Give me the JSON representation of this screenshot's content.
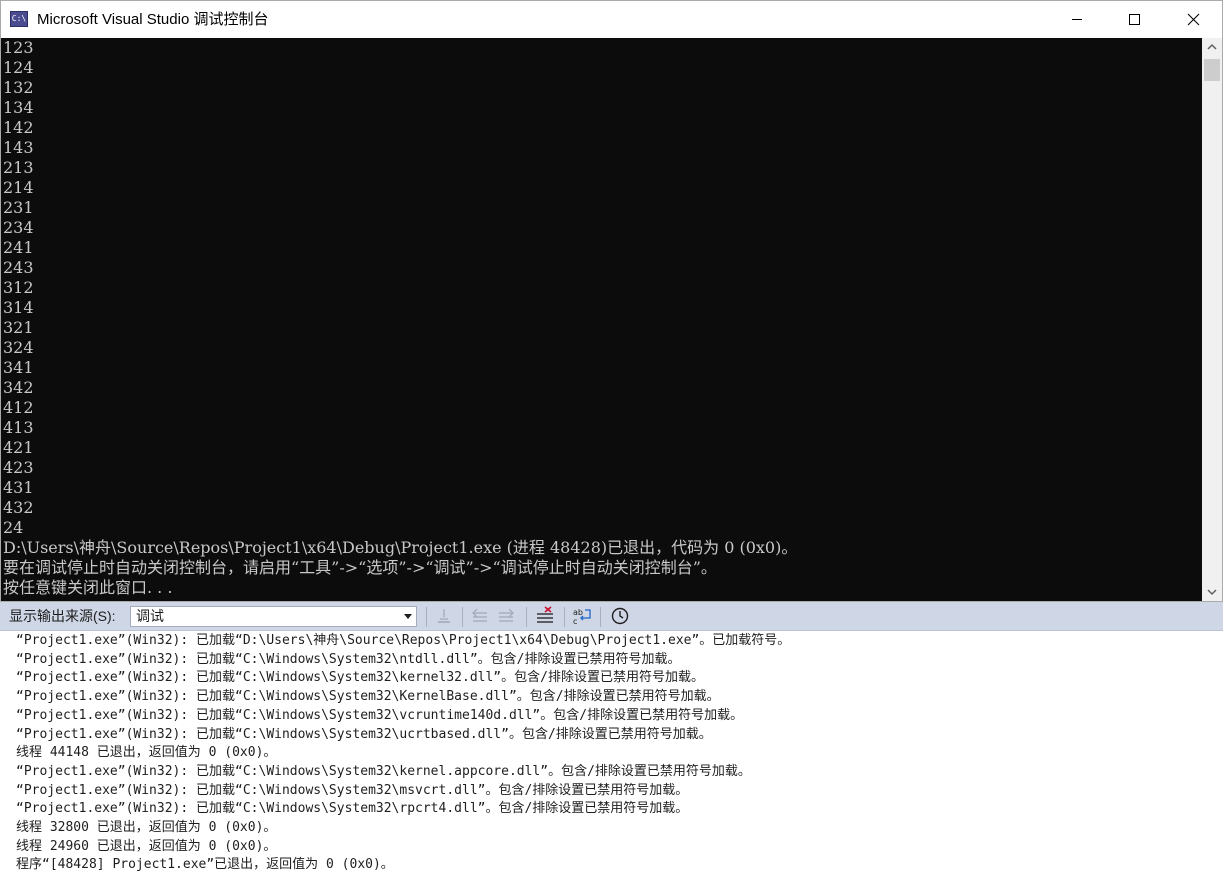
{
  "window": {
    "icon_text": "C:\\",
    "title": "Microsoft Visual Studio 调试控制台"
  },
  "console": {
    "lines": [
      "123",
      "124",
      "132",
      "134",
      "142",
      "143",
      "213",
      "214",
      "231",
      "234",
      "241",
      "243",
      "312",
      "314",
      "321",
      "324",
      "341",
      "342",
      "412",
      "413",
      "421",
      "423",
      "431",
      "432",
      "24",
      "D:\\Users\\神舟\\Source\\Repos\\Project1\\x64\\Debug\\Project1.exe (进程 48428)已退出，代码为 0 (0x0)。",
      "要在调试停止时自动关闭控制台，请启用“工具”->“选项”->“调试”->“调试停止时自动关闭控制台”。",
      "按任意键关闭此窗口. . ."
    ]
  },
  "output": {
    "source_label": "显示输出来源(S):",
    "source_value": "调试",
    "lines": [
      "“Project1.exe”(Win32): 已加载“D:\\Users\\神舟\\Source\\Repos\\Project1\\x64\\Debug\\Project1.exe”。已加载符号。",
      "“Project1.exe”(Win32): 已加载“C:\\Windows\\System32\\ntdll.dll”。包含/排除设置已禁用符号加载。",
      "“Project1.exe”(Win32): 已加载“C:\\Windows\\System32\\kernel32.dll”。包含/排除设置已禁用符号加载。",
      "“Project1.exe”(Win32): 已加载“C:\\Windows\\System32\\KernelBase.dll”。包含/排除设置已禁用符号加载。",
      "“Project1.exe”(Win32): 已加载“C:\\Windows\\System32\\vcruntime140d.dll”。包含/排除设置已禁用符号加载。",
      "“Project1.exe”(Win32): 已加载“C:\\Windows\\System32\\ucrtbased.dll”。包含/排除设置已禁用符号加载。",
      "线程 44148 已退出，返回值为 0 (0x0)。",
      "“Project1.exe”(Win32): 已加载“C:\\Windows\\System32\\kernel.appcore.dll”。包含/排除设置已禁用符号加载。",
      "“Project1.exe”(Win32): 已加载“C:\\Windows\\System32\\msvcrt.dll”。包含/排除设置已禁用符号加载。",
      "“Project1.exe”(Win32): 已加载“C:\\Windows\\System32\\rpcrt4.dll”。包含/排除设置已禁用符号加载。",
      "线程 32800 已退出，返回值为 0 (0x0)。",
      "线程 24960 已退出，返回值为 0 (0x0)。",
      "程序“[48428] Project1.exe”已退出，返回值为 0 (0x0)。"
    ]
  },
  "icons": {
    "app": "console-app-icon",
    "minimize": "minimize-icon",
    "maximize": "maximize-icon",
    "close": "close-icon",
    "scroll_up": "arrow-up-icon",
    "scroll_down": "arrow-down-icon",
    "find_message": "find-message-icon",
    "prev_message": "previous-message-icon",
    "next_message": "next-message-icon",
    "clear_all": "clear-all-icon",
    "word_wrap": "word-wrap-icon",
    "timestamp": "clock-icon"
  },
  "colors": {
    "console_bg": "#0c0c0c",
    "console_text": "#c8c8c8",
    "toolbar_bg": "#cfd6e5",
    "output_bg": "#ffffff"
  }
}
